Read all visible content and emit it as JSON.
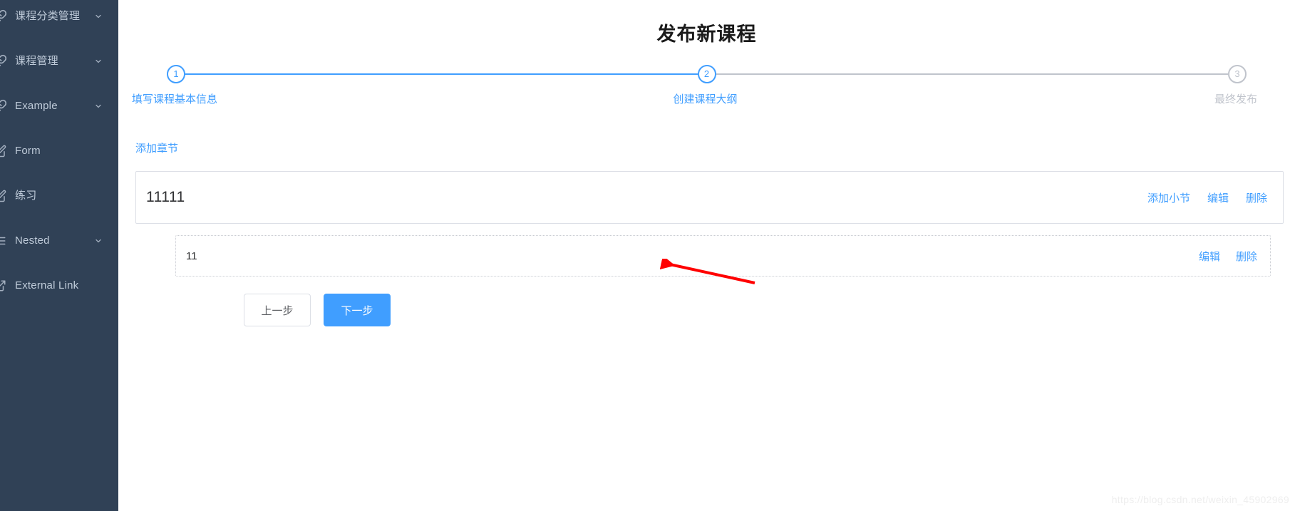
{
  "sidebar": {
    "background_color": "#304156",
    "text_color": "#bfcbd9",
    "items": [
      {
        "label": "课程分类管理",
        "icon": "link-icon",
        "has_arrow": true
      },
      {
        "label": "课程管理",
        "icon": "link-icon",
        "has_arrow": true
      },
      {
        "label": "Example",
        "icon": "link-icon",
        "has_arrow": true
      },
      {
        "label": "Form",
        "icon": "form-icon",
        "has_arrow": false
      },
      {
        "label": "练习",
        "icon": "form-icon",
        "has_arrow": false
      },
      {
        "label": "Nested",
        "icon": "nested-list-icon",
        "has_arrow": true
      },
      {
        "label": "External Link",
        "icon": "external-link-icon",
        "has_arrow": false
      }
    ]
  },
  "header": {
    "title": "发布新课程"
  },
  "steps": {
    "active_index": 2,
    "accent_color": "#409eff",
    "inactive_color": "#c0c4cc",
    "items": [
      {
        "number": "1",
        "label": "填写课程基本信息",
        "state": "done"
      },
      {
        "number": "2",
        "label": "创建课程大纲",
        "state": "active"
      },
      {
        "number": "3",
        "label": "最终发布",
        "state": "pending"
      }
    ]
  },
  "content": {
    "add_chapter_label": "添加章节",
    "chapter": {
      "title": "11111",
      "actions": [
        {
          "label": "添加小节"
        },
        {
          "label": "编辑"
        },
        {
          "label": "删除"
        }
      ],
      "sections": [
        {
          "title": "11",
          "actions": [
            {
              "label": "编辑"
            },
            {
              "label": "删除"
            }
          ]
        }
      ]
    },
    "buttons": {
      "prev_label": "上一步",
      "next_label": "下一步"
    }
  },
  "annotation": {
    "arrow_color": "#ff0000"
  },
  "watermark": {
    "text": "https://blog.csdn.net/weixin_45902969"
  }
}
